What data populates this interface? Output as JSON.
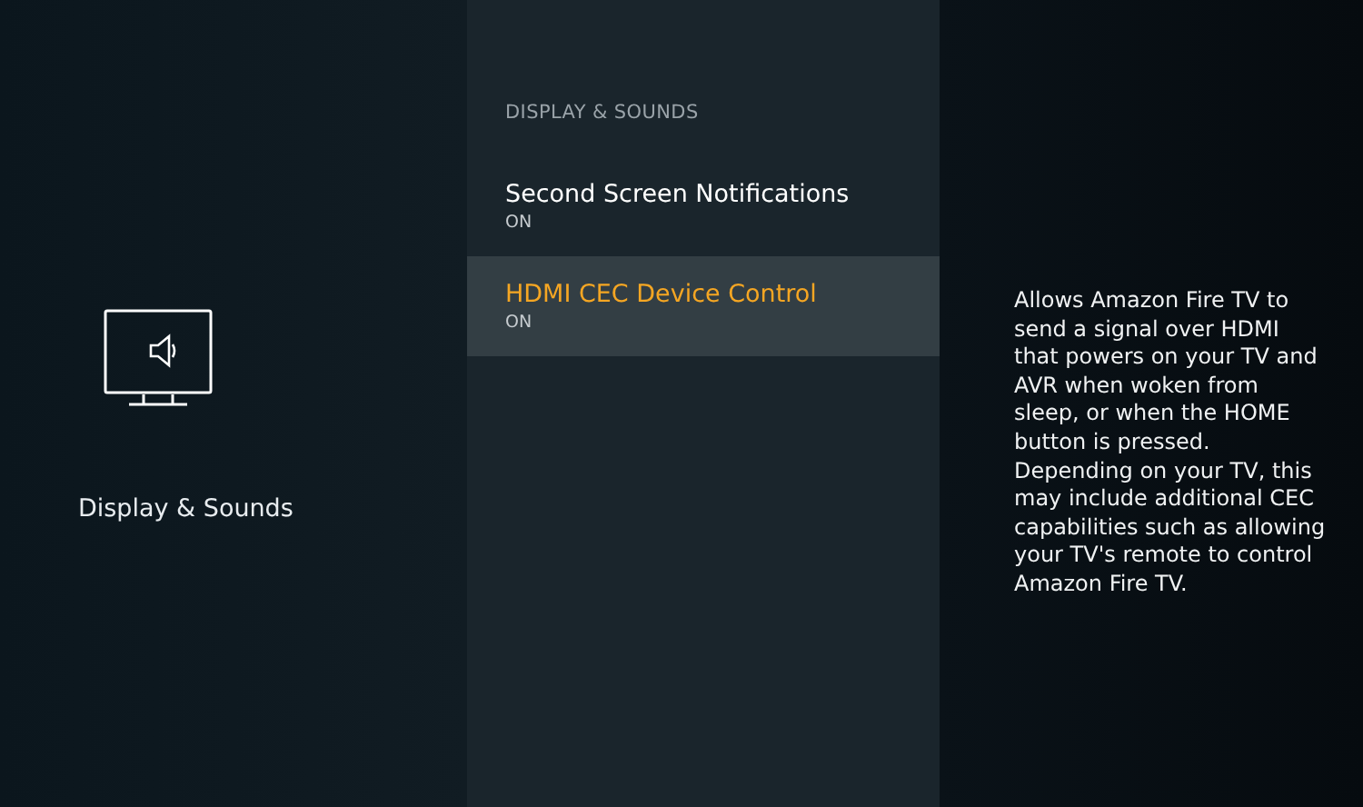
{
  "category": {
    "label": "Display & Sounds"
  },
  "menu": {
    "heading": "DISPLAY & SOUNDS",
    "items": [
      {
        "label": "Second Screen Notifications",
        "value": "ON",
        "selected": false
      },
      {
        "label": "HDMI CEC Device Control",
        "value": "ON",
        "selected": true
      }
    ]
  },
  "description": "Allows Amazon Fire TV to send a signal over HDMI that powers on your TV and AVR when woken from sleep, or when the HOME button is pressed. Depending on your TV, this may include additional CEC capabilities such as allowing your TV's remote to control Amazon Fire TV."
}
